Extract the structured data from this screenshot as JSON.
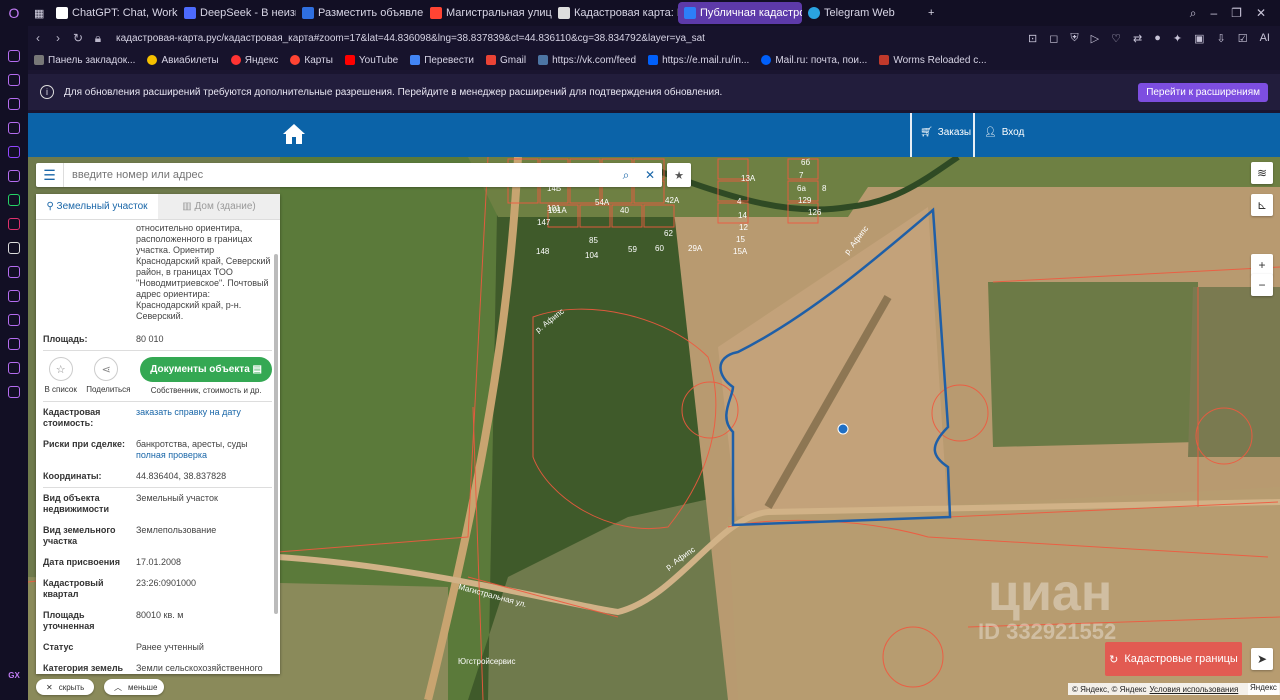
{
  "browser": {
    "tabs": [
      {
        "title": "ChatGPT: Chat, Work, Crea",
        "color": "#ffffff"
      },
      {
        "title": "DeepSeek - В неизвестно",
        "color": "#4d6bfe"
      },
      {
        "title": "Разместить объявление о",
        "color": "#2f6fe0"
      },
      {
        "title": "Магистральная улица — Я",
        "color": "#ff4433"
      },
      {
        "title": "Кадастровая карта: Красн",
        "color": "#ffffff"
      },
      {
        "title": "Публичная кадастровая к",
        "color": "#2d7ff9",
        "active": true
      },
      {
        "title": "Telegram Web",
        "color": "#2aa3e0"
      }
    ],
    "new_tab": "+",
    "url": "кадастровая-карта.рус/кадастровая_карта#zoom=17&lat=44.836098&lng=38.837839&ct=44.836110&cg=38.834792&layer=ya_sat",
    "bookmarks": [
      {
        "label": "Панель закладок...",
        "color": "#777"
      },
      {
        "label": "Авиабилеты",
        "color": "#f5c000"
      },
      {
        "label": "Яндекс",
        "color": "#ff3333"
      },
      {
        "label": "Карты",
        "color": "#ff4433"
      },
      {
        "label": "YouTube",
        "color": "#ff0000"
      },
      {
        "label": "Перевести",
        "color": "#4285f4"
      },
      {
        "label": "Gmail",
        "color": "#ea4335"
      },
      {
        "label": "https://vk.com/feed",
        "color": "#4c75a3"
      },
      {
        "label": "https://e.mail.ru/in...",
        "color": "#005ff9"
      },
      {
        "label": "Mail.ru: почта, пои...",
        "color": "#005ff9"
      },
      {
        "label": "Worms Reloaded c...",
        "color": "#c0392b"
      }
    ]
  },
  "infobar": {
    "message": "Для обновления расширений требуются дополнительные разрешения. Перейдите в менеджер расширений для подтверждения обновления.",
    "button": "Перейти к расширениям"
  },
  "header": {
    "orders": "Заказы",
    "login": "Вход"
  },
  "search": {
    "placeholder": "введите номер или адрес"
  },
  "panel": {
    "tab_land": "Земельный участок",
    "tab_house": "Дом (здание)",
    "address_desc": "относительно ориентира,\nрасположенного в границах\nучастка. Ориентир\nКраснодарский край, Северский\nрайон, в границах ТОО\n\"Новодмитриевское\". Почтовый\nадрес ориентира:\nКраснодарский край, р-н.\nСеверский.",
    "area_label": "Площадь:",
    "area_value": "80 010",
    "fav_label": "В список",
    "share_label": "Поделиться",
    "docs_button": "Документы объекта",
    "docs_sub": "Собственник, стоимость и др.",
    "cost_label": "Кадастровая стоимость:",
    "cost_link": "заказать справку на дату",
    "risk_label": "Риски при сделке:",
    "risk_value": "банкротства, аресты, суды",
    "risk_link": "полная проверка",
    "coords_label": "Координаты:",
    "coords_value": "44.836404, 38.837828",
    "type_label": "Вид объекта недвижимости",
    "type_value": "Земельный участок",
    "land_kind_label": "Вид земельного участка",
    "land_kind_value": "Землепользование",
    "date_label": "Дата присвоения",
    "date_value": "17.01.2008",
    "quarter_label": "Кадастровый квартал",
    "quarter_value": "23:26:0901000",
    "area_prec_label": "Площадь уточненная",
    "area_prec_value": "80010 кв. м",
    "status_label": "Статус",
    "status_value": "Ранее учтенный",
    "category_label": "Категория земель",
    "category_value": "Земли сельскохозяйственного назначения"
  },
  "bottom": {
    "hide": "скрыть",
    "less": "меньше"
  },
  "map": {
    "cad_button": "Кадастровые границы",
    "copyright": "© Яндекс, © Яндекс",
    "terms": "Условия использования",
    "yandex": "Яндекс",
    "river_label_1": "р. Афипс",
    "river_label_2": "р. Афипс",
    "river_label_3": "р. Афипс",
    "street_label": "Магистральная ул.",
    "poi_label": "Югстройсервис",
    "watermark": "циан",
    "watermark_id": "ID 332921552",
    "parcel_numbers": [
      "14Б",
      "101",
      "54А",
      "42А",
      "13А",
      "101А",
      "40",
      "4",
      "14",
      "147",
      "85",
      "62",
      "12",
      "15",
      "15А",
      "148",
      "59",
      "60",
      "29А",
      "7",
      "129",
      "104",
      "6а",
      "126",
      "6б",
      "8"
    ]
  }
}
